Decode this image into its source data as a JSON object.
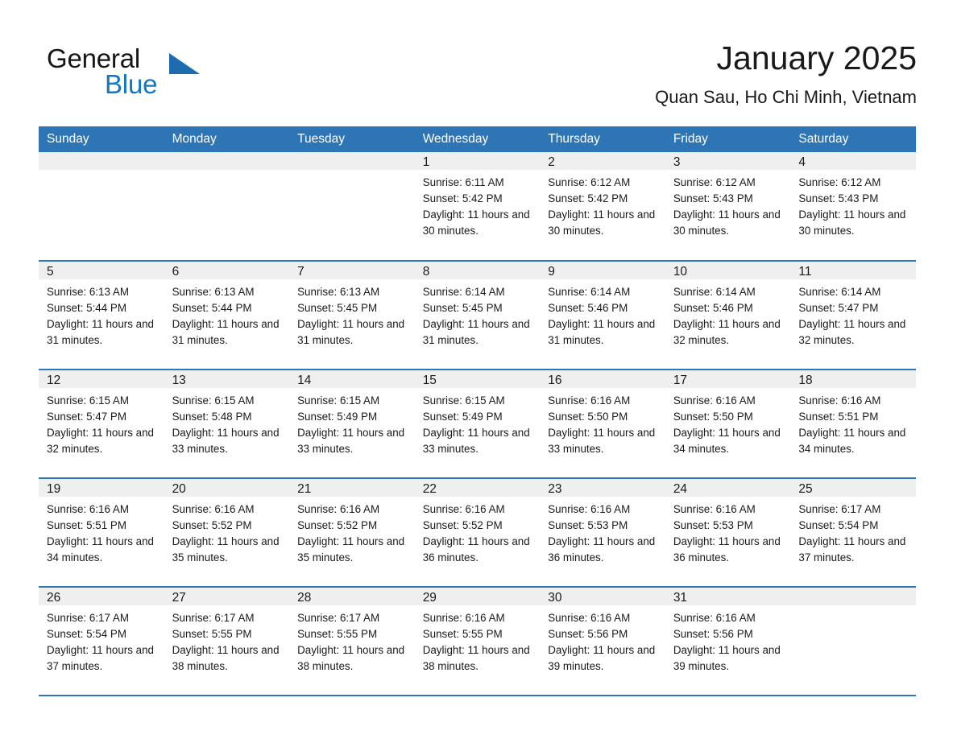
{
  "brand": {
    "line1": "General",
    "line2": "Blue",
    "triangle_color": "#1d6cb0"
  },
  "header": {
    "title": "January 2025",
    "subtitle": "Quan Sau, Ho Chi Minh, Vietnam"
  },
  "theme": {
    "header_blue": "#2e75b6",
    "daynum_band": "#efefef",
    "text": "#1a1a1a",
    "brand_blue": "#1476c6"
  },
  "weekday_headers": [
    "Sunday",
    "Monday",
    "Tuesday",
    "Wednesday",
    "Thursday",
    "Friday",
    "Saturday"
  ],
  "weeks": [
    [
      {
        "day": "",
        "blank": true
      },
      {
        "day": "",
        "blank": true
      },
      {
        "day": "",
        "blank": true
      },
      {
        "day": "1",
        "sunrise": "Sunrise: 6:11 AM",
        "sunset": "Sunset: 5:42 PM",
        "daylight": "Daylight: 11 hours and 30 minutes."
      },
      {
        "day": "2",
        "sunrise": "Sunrise: 6:12 AM",
        "sunset": "Sunset: 5:42 PM",
        "daylight": "Daylight: 11 hours and 30 minutes."
      },
      {
        "day": "3",
        "sunrise": "Sunrise: 6:12 AM",
        "sunset": "Sunset: 5:43 PM",
        "daylight": "Daylight: 11 hours and 30 minutes."
      },
      {
        "day": "4",
        "sunrise": "Sunrise: 6:12 AM",
        "sunset": "Sunset: 5:43 PM",
        "daylight": "Daylight: 11 hours and 30 minutes."
      }
    ],
    [
      {
        "day": "5",
        "sunrise": "Sunrise: 6:13 AM",
        "sunset": "Sunset: 5:44 PM",
        "daylight": "Daylight: 11 hours and 31 minutes."
      },
      {
        "day": "6",
        "sunrise": "Sunrise: 6:13 AM",
        "sunset": "Sunset: 5:44 PM",
        "daylight": "Daylight: 11 hours and 31 minutes."
      },
      {
        "day": "7",
        "sunrise": "Sunrise: 6:13 AM",
        "sunset": "Sunset: 5:45 PM",
        "daylight": "Daylight: 11 hours and 31 minutes."
      },
      {
        "day": "8",
        "sunrise": "Sunrise: 6:14 AM",
        "sunset": "Sunset: 5:45 PM",
        "daylight": "Daylight: 11 hours and 31 minutes."
      },
      {
        "day": "9",
        "sunrise": "Sunrise: 6:14 AM",
        "sunset": "Sunset: 5:46 PM",
        "daylight": "Daylight: 11 hours and 31 minutes."
      },
      {
        "day": "10",
        "sunrise": "Sunrise: 6:14 AM",
        "sunset": "Sunset: 5:46 PM",
        "daylight": "Daylight: 11 hours and 32 minutes."
      },
      {
        "day": "11",
        "sunrise": "Sunrise: 6:14 AM",
        "sunset": "Sunset: 5:47 PM",
        "daylight": "Daylight: 11 hours and 32 minutes."
      }
    ],
    [
      {
        "day": "12",
        "sunrise": "Sunrise: 6:15 AM",
        "sunset": "Sunset: 5:47 PM",
        "daylight": "Daylight: 11 hours and 32 minutes."
      },
      {
        "day": "13",
        "sunrise": "Sunrise: 6:15 AM",
        "sunset": "Sunset: 5:48 PM",
        "daylight": "Daylight: 11 hours and 33 minutes."
      },
      {
        "day": "14",
        "sunrise": "Sunrise: 6:15 AM",
        "sunset": "Sunset: 5:49 PM",
        "daylight": "Daylight: 11 hours and 33 minutes."
      },
      {
        "day": "15",
        "sunrise": "Sunrise: 6:15 AM",
        "sunset": "Sunset: 5:49 PM",
        "daylight": "Daylight: 11 hours and 33 minutes."
      },
      {
        "day": "16",
        "sunrise": "Sunrise: 6:16 AM",
        "sunset": "Sunset: 5:50 PM",
        "daylight": "Daylight: 11 hours and 33 minutes."
      },
      {
        "day": "17",
        "sunrise": "Sunrise: 6:16 AM",
        "sunset": "Sunset: 5:50 PM",
        "daylight": "Daylight: 11 hours and 34 minutes."
      },
      {
        "day": "18",
        "sunrise": "Sunrise: 6:16 AM",
        "sunset": "Sunset: 5:51 PM",
        "daylight": "Daylight: 11 hours and 34 minutes."
      }
    ],
    [
      {
        "day": "19",
        "sunrise": "Sunrise: 6:16 AM",
        "sunset": "Sunset: 5:51 PM",
        "daylight": "Daylight: 11 hours and 34 minutes."
      },
      {
        "day": "20",
        "sunrise": "Sunrise: 6:16 AM",
        "sunset": "Sunset: 5:52 PM",
        "daylight": "Daylight: 11 hours and 35 minutes."
      },
      {
        "day": "21",
        "sunrise": "Sunrise: 6:16 AM",
        "sunset": "Sunset: 5:52 PM",
        "daylight": "Daylight: 11 hours and 35 minutes."
      },
      {
        "day": "22",
        "sunrise": "Sunrise: 6:16 AM",
        "sunset": "Sunset: 5:52 PM",
        "daylight": "Daylight: 11 hours and 36 minutes."
      },
      {
        "day": "23",
        "sunrise": "Sunrise: 6:16 AM",
        "sunset": "Sunset: 5:53 PM",
        "daylight": "Daylight: 11 hours and 36 minutes."
      },
      {
        "day": "24",
        "sunrise": "Sunrise: 6:16 AM",
        "sunset": "Sunset: 5:53 PM",
        "daylight": "Daylight: 11 hours and 36 minutes."
      },
      {
        "day": "25",
        "sunrise": "Sunrise: 6:17 AM",
        "sunset": "Sunset: 5:54 PM",
        "daylight": "Daylight: 11 hours and 37 minutes."
      }
    ],
    [
      {
        "day": "26",
        "sunrise": "Sunrise: 6:17 AM",
        "sunset": "Sunset: 5:54 PM",
        "daylight": "Daylight: 11 hours and 37 minutes."
      },
      {
        "day": "27",
        "sunrise": "Sunrise: 6:17 AM",
        "sunset": "Sunset: 5:55 PM",
        "daylight": "Daylight: 11 hours and 38 minutes."
      },
      {
        "day": "28",
        "sunrise": "Sunrise: 6:17 AM",
        "sunset": "Sunset: 5:55 PM",
        "daylight": "Daylight: 11 hours and 38 minutes."
      },
      {
        "day": "29",
        "sunrise": "Sunrise: 6:16 AM",
        "sunset": "Sunset: 5:55 PM",
        "daylight": "Daylight: 11 hours and 38 minutes."
      },
      {
        "day": "30",
        "sunrise": "Sunrise: 6:16 AM",
        "sunset": "Sunset: 5:56 PM",
        "daylight": "Daylight: 11 hours and 39 minutes."
      },
      {
        "day": "31",
        "sunrise": "Sunrise: 6:16 AM",
        "sunset": "Sunset: 5:56 PM",
        "daylight": "Daylight: 11 hours and 39 minutes."
      },
      {
        "day": "",
        "blank": true
      }
    ]
  ]
}
